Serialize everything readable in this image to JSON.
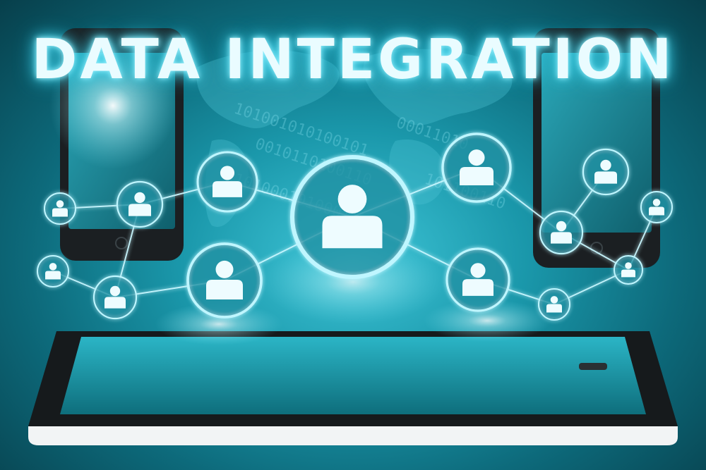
{
  "title": "DATA INTEGRATION",
  "colors": {
    "background": "#1a97aa",
    "glow": "#bff6ff",
    "node_fill": "#1e8fa3",
    "device": "#1b1f22",
    "tablet_frame": "#f2f4f5"
  },
  "icons": [
    "person-icon",
    "smartphone",
    "tablet",
    "world-map",
    "binary-digits"
  ]
}
